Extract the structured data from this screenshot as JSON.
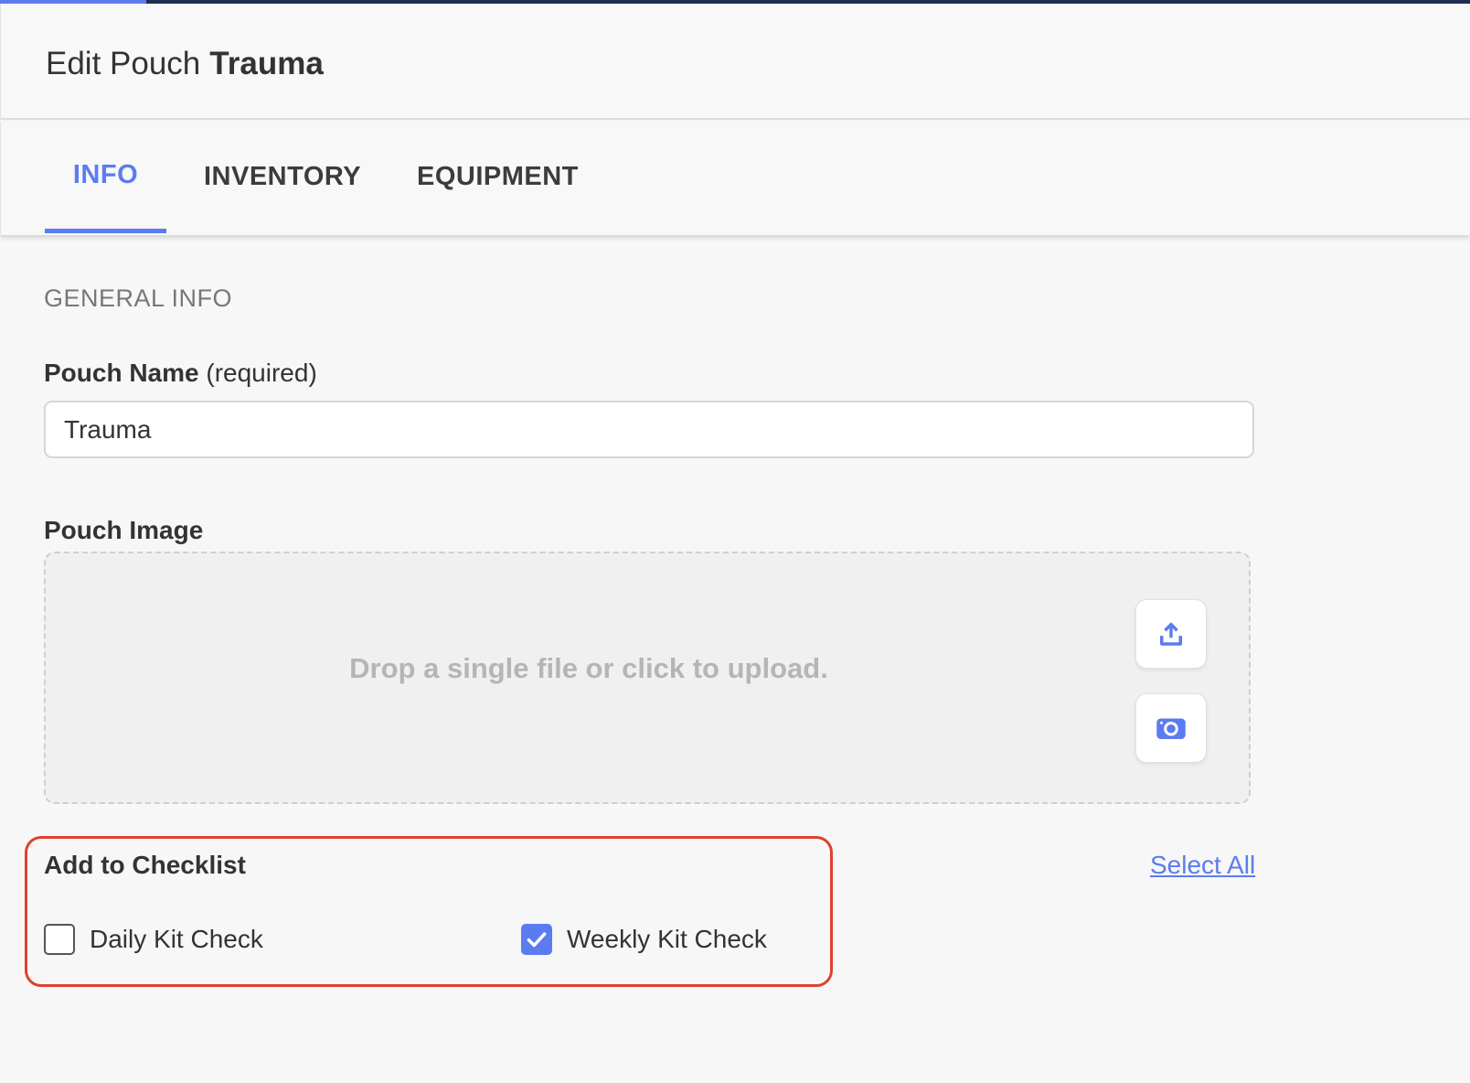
{
  "header": {
    "title_prefix": "Edit Pouch",
    "title_entity": "Trauma"
  },
  "tabs": [
    {
      "label": "INFO",
      "active": true
    },
    {
      "label": "INVENTORY",
      "active": false
    },
    {
      "label": "EQUIPMENT",
      "active": false
    }
  ],
  "general_info": {
    "section_title": "GENERAL INFO",
    "pouch_name": {
      "label": "Pouch Name",
      "qualifier": "(required)",
      "value": "Trauma"
    },
    "pouch_image": {
      "label": "Pouch Image",
      "prompt": "Drop a single file or click to upload.",
      "upload_icon": "upload-icon",
      "camera_icon": "camera-icon"
    }
  },
  "checklist": {
    "title": "Add to Checklist",
    "select_all_label": "Select All",
    "items": [
      {
        "label": "Daily Kit Check",
        "checked": false
      },
      {
        "label": "Weekly Kit Check",
        "checked": true
      }
    ]
  },
  "colors": {
    "accent": "#5b7cf0",
    "highlight_border": "#e0402f",
    "top_bar": "#1f2d52"
  }
}
